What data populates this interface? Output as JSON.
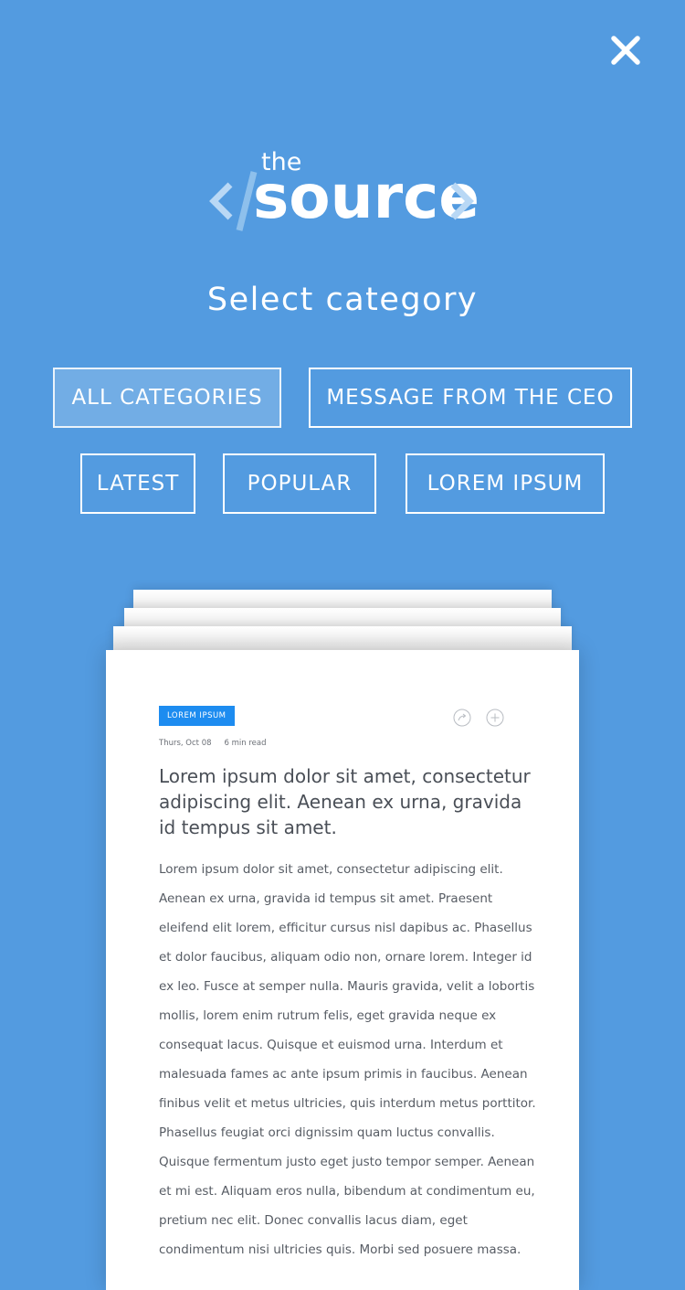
{
  "header": {
    "close_icon": "close-icon"
  },
  "logo": {
    "the": "the",
    "source": "source"
  },
  "title": "Select category",
  "categories": [
    {
      "label": "ALL CATEGORIES",
      "active": true
    },
    {
      "label": "MESSAGE FROM THE CEO",
      "active": false
    },
    {
      "label": "LATEST",
      "active": false
    },
    {
      "label": "POPULAR",
      "active": false
    },
    {
      "label": "LOREM IPSUM",
      "active": false
    }
  ],
  "article": {
    "tag": "LOREM IPSUM",
    "date": "Thurs, Oct 08",
    "read_time": "6 min read",
    "headline": "Lorem ipsum dolor sit amet, consectetur adipiscing elit. Aenean ex urna, gravida id tempus sit amet.",
    "body": "Lorem ipsum dolor sit amet, consectetur adipiscing elit. Aenean ex urna, gravida id tempus sit amet. Praesent eleifend elit lorem, efficitur cursus nisl dapibus ac. Phasellus et dolor faucibus, aliquam odio non, ornare lorem. Integer id ex leo. Fusce at semper nulla. Mauris gravida, velit a lobortis mollis, lorem enim rutrum felis, eget gravida neque ex consequat lacus. Quisque et euismod urna. Interdum et malesuada fames ac ante ipsum primis in faucibus. Aenean finibus velit et metus ultricies, quis interdum metus porttitor. Phasellus feugiat orci dignissim quam luctus convallis. Quisque fermentum justo eget justo tempor semper. Aenean et mi est. Aliquam eros nulla, bibendum at condimentum eu, pretium nec elit. Donec convallis lacus diam, eget condimentum nisi ultricies quis. Morbi sed posuere massa."
  },
  "colors": {
    "background": "#539be0",
    "tag": "#1d8cf0",
    "text": "#575c64"
  }
}
